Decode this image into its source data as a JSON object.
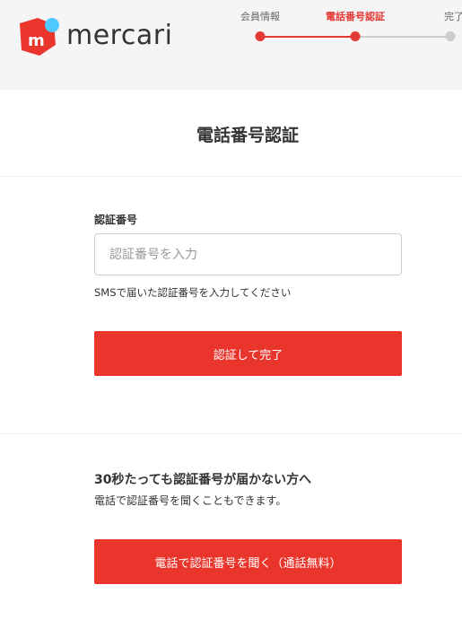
{
  "brand": {
    "name": "mercari",
    "colors": {
      "primary": "#ea352d",
      "accent_blue": "#4dc9ff",
      "inactive": "#cccccc"
    }
  },
  "steps": [
    {
      "label": "会員情報",
      "state": "done"
    },
    {
      "label": "電話番号認証",
      "state": "current"
    },
    {
      "label": "完了",
      "state": "todo"
    }
  ],
  "page": {
    "title": "電話番号認証"
  },
  "form": {
    "label": "認証番号",
    "placeholder": "認証番号を入力",
    "value": "",
    "help": "SMSで届いた認証番号を入力してください",
    "submit_label": "認証して完了"
  },
  "fallback": {
    "heading": "30秒たっても認証番号が届かない方へ",
    "description": "電話で認証番号を聞くこともできます。",
    "call_label": "電話で認証番号を聞く（通話無料）"
  }
}
